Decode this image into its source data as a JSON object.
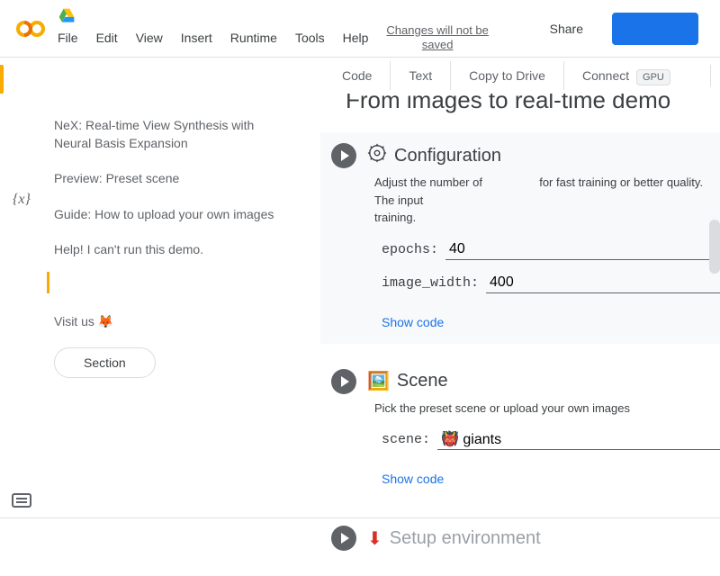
{
  "header": {
    "menus": [
      "File",
      "Edit",
      "View",
      "Insert",
      "Runtime",
      "Tools",
      "Help"
    ],
    "changes_line1": "Changes will not be",
    "changes_line2": "saved",
    "share": "Share"
  },
  "toolbar": {
    "code": "Code",
    "text": "Text",
    "copy": "Copy to Drive",
    "connect": "Connect",
    "gpu": "GPU"
  },
  "toc": {
    "items": [
      "NeX: Real-time View Synthesis with Neural Basis Expansion",
      "Preview: Preset scene",
      "Guide: How to upload your own images",
      "Help! I can't run this demo."
    ],
    "visit": "Visit us 🦊",
    "section_btn": "Section"
  },
  "content": {
    "title": "From images to real-time demo",
    "cells": [
      {
        "icon": "⚙️",
        "title": "Configuration",
        "desc_a": "Adjust the number of",
        "desc_b": "for fast training or better quality. The input",
        "desc_c": "training.",
        "fields": [
          {
            "label": "epochs:",
            "value": "40"
          },
          {
            "label": "image_width:",
            "value": "400"
          }
        ],
        "show_code": "Show code"
      },
      {
        "icon": "🖼️",
        "title": "Scene",
        "desc": "Pick the preset scene or upload your own images",
        "fields": [
          {
            "label": "scene:",
            "value": "👹 giants"
          }
        ],
        "show_code": "Show code"
      },
      {
        "icon": "⬇",
        "title": "Setup environment"
      }
    ]
  }
}
